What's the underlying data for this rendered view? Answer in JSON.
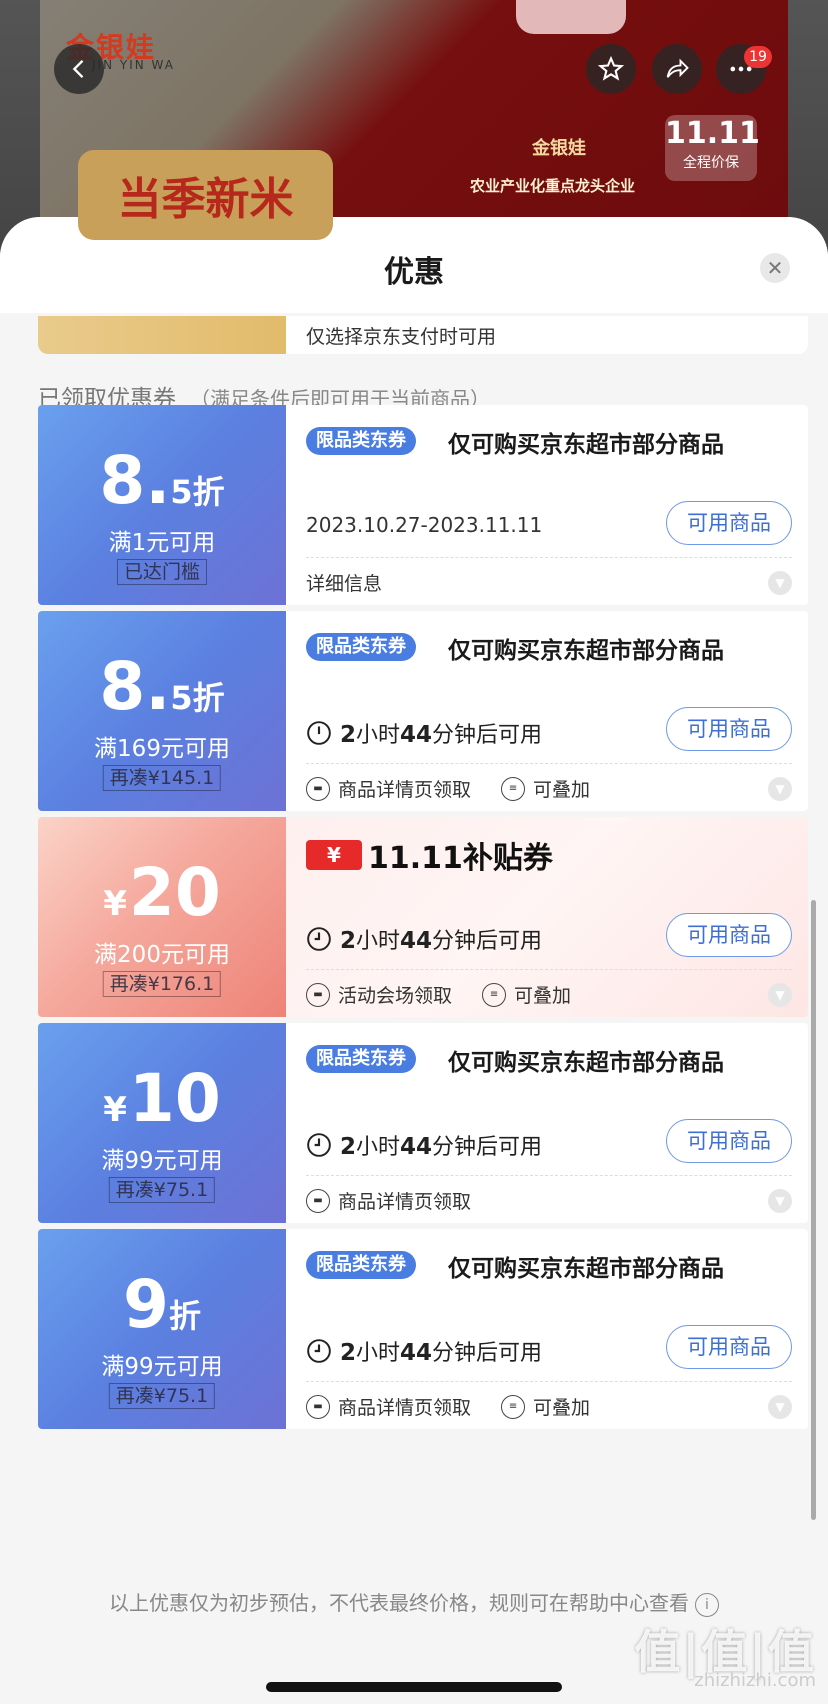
{
  "hero": {
    "brand": "金银娃",
    "brand_en": "JIN YIN WA",
    "banner": "当季新米",
    "bag_brand": "金银娃",
    "bag_slogan": "农业产业化重点龙头企业",
    "badge_main": "11.11",
    "badge_sub": "全程价保",
    "more_count": "19"
  },
  "sheet": {
    "title": "优惠",
    "prev_note": "仅选择京东支付时可用",
    "section_label": "已领取优惠券",
    "section_sub": "（满足条件后即可用于当前商品）",
    "disclaimer": "以上优惠仅为初步预估，不代表最终价格，规则可在帮助中心查看"
  },
  "coupons": [
    {
      "value": "8.",
      "value_small": "5",
      "unit": "折",
      "condition": "满1元可用",
      "hint": "已达门槛",
      "tag": "限品类东券",
      "title": "仅可购买京东超市部分商品",
      "date": "2023.10.27-2023.11.11",
      "button": "可用商品",
      "detail": "详细信息"
    },
    {
      "value": "8.",
      "value_small": "5",
      "unit": "折",
      "condition": "满169元可用",
      "hint": "再凑¥145.1",
      "tag": "限品类东券",
      "title": "仅可购买京东超市部分商品",
      "time_prefix": "2",
      "time_mid": "小时",
      "time_num": "44",
      "time_suffix": "分钟后可用",
      "button": "可用商品",
      "source": "商品详情页领取",
      "stack": "可叠加"
    },
    {
      "yen": "¥",
      "value": "20",
      "condition": "满200元可用",
      "hint": "再凑¥176.1",
      "chip": "¥",
      "title": "11.11补贴券",
      "time_prefix": "2",
      "time_mid": "小时",
      "time_num": "44",
      "time_suffix": "分钟后可用",
      "button": "可用商品",
      "source": "活动会场领取",
      "stack": "可叠加"
    },
    {
      "yen": "¥",
      "value": "10",
      "condition": "满99元可用",
      "hint": "再凑¥75.1",
      "tag": "限品类东券",
      "title": "仅可购买京东超市部分商品",
      "time_prefix": "2",
      "time_mid": "小时",
      "time_num": "44",
      "time_suffix": "分钟后可用",
      "button": "可用商品",
      "source": "商品详情页领取"
    },
    {
      "value": "9",
      "unit": "折",
      "condition": "满99元可用",
      "hint": "再凑¥75.1",
      "tag": "限品类东券",
      "title": "仅可购买京东超市部分商品",
      "time_prefix": "2",
      "time_mid": "小时",
      "time_num": "44",
      "time_suffix": "分钟后可用",
      "button": "可用商品",
      "source": "商品详情页领取",
      "stack": "可叠加"
    }
  ],
  "watermark": {
    "text": "值|值|值",
    "url": "zhizhizhi.com"
  },
  "colors": {
    "accent_blue": "#4a7de2",
    "coupon_blue": "#5b80e0",
    "subsidy_red": "#e62a2a"
  }
}
